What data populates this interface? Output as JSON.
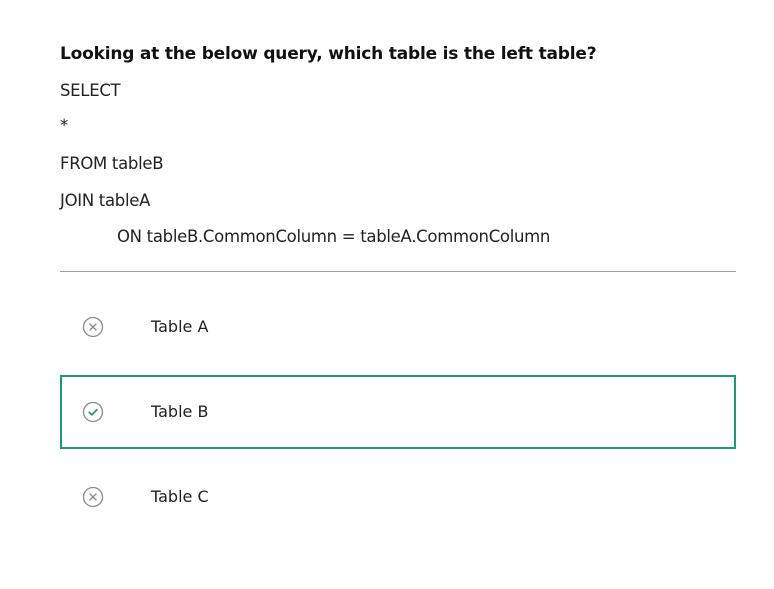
{
  "question": {
    "text": "Looking at the below query, which table is the left table?",
    "code_lines": [
      "SELECT",
      "*",
      "FROM tableB",
      "JOIN tableA",
      "ON tableB.CommonColumn = tableA.CommonColumn"
    ]
  },
  "options": [
    {
      "label": "Table A",
      "status": "incorrect",
      "icon": "close-circle-icon",
      "selected": false
    },
    {
      "label": "Table B",
      "status": "correct",
      "icon": "check-circle-icon",
      "selected": true
    },
    {
      "label": "Table C",
      "status": "incorrect",
      "icon": "close-circle-icon",
      "selected": false
    }
  ],
  "colors": {
    "correct_accent": "#1f9a6f",
    "icon_gray": "#8a8a8a",
    "divider": "#9e9e9e"
  }
}
